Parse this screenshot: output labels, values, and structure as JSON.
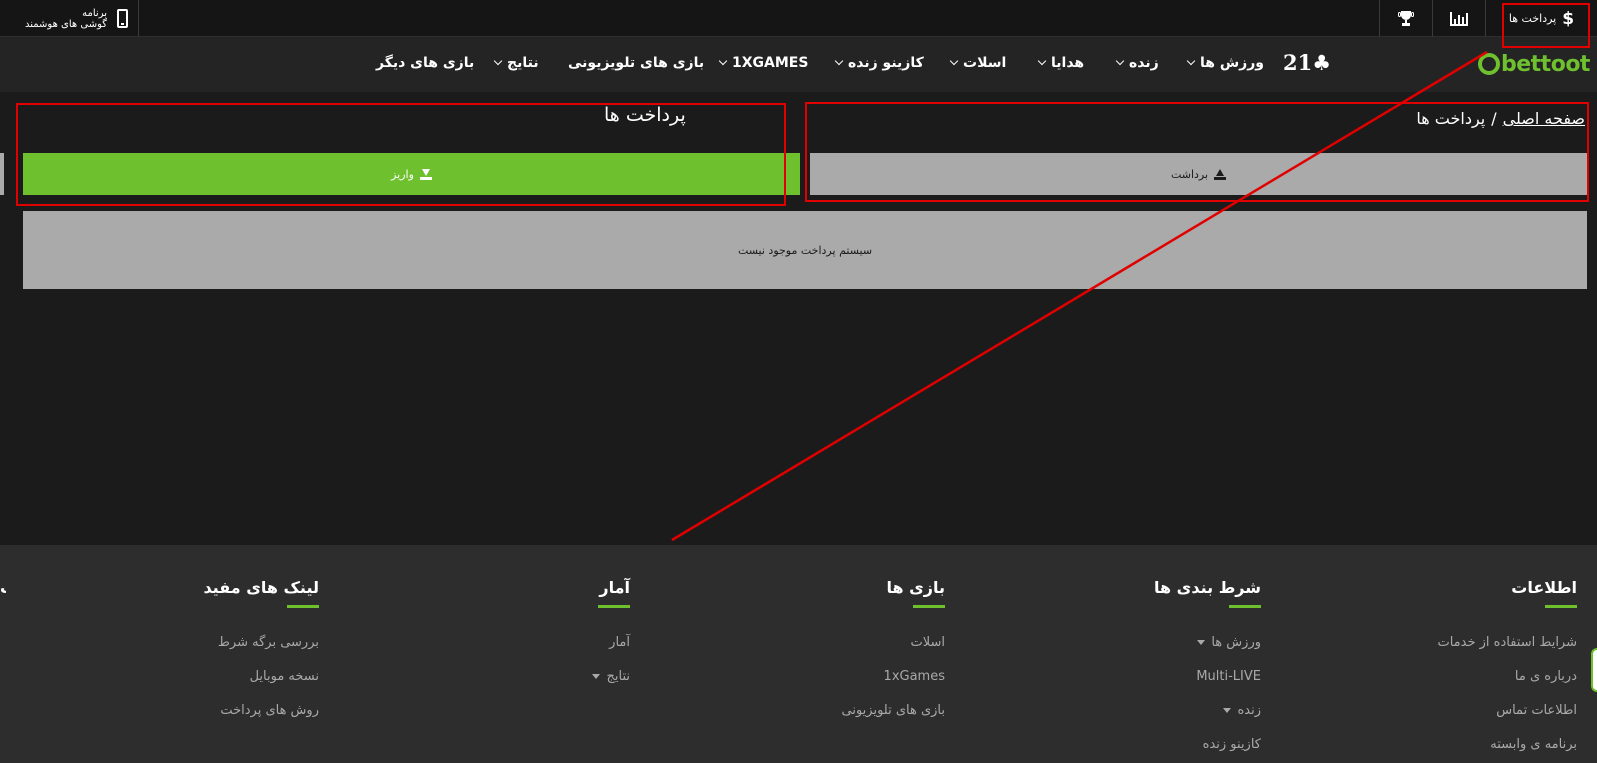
{
  "topbar": {
    "app_line1": "برنامه",
    "app_line2": "گوشی های هوشمند",
    "payments_label": "پرداخت ها",
    "dollar_symbol": "$"
  },
  "brand": {
    "logo_text": "bettoot",
    "logo21": "21♣"
  },
  "nav": {
    "items": [
      {
        "label": "ورزش ها",
        "dropdown": true
      },
      {
        "label": "زنده",
        "dropdown": true
      },
      {
        "label": "هدایا",
        "dropdown": true
      },
      {
        "label": "اسلات",
        "dropdown": true
      },
      {
        "label": "کازینو زنده",
        "dropdown": true
      },
      {
        "label": "1XGAMES",
        "dropdown": true
      },
      {
        "label": "بازی های تلویزیونی",
        "dropdown": false
      },
      {
        "label": "نتایج",
        "dropdown": true
      },
      {
        "label": "بازی های دیگر",
        "dropdown": false
      }
    ]
  },
  "breadcrumb": {
    "home": "صفحه اصلی",
    "separator": "/",
    "current": "پرداخت ها"
  },
  "page": {
    "title": "پرداخت ها",
    "deposit_label": "واریز",
    "withdraw_label": "برداشت",
    "notice": "سیستم پرداخت موجود نیست"
  },
  "footer": {
    "columns": [
      {
        "heading": "اطلاعات",
        "links": [
          {
            "label": "شرایط استفاده از خدمات"
          },
          {
            "label": "درباره ی ما"
          },
          {
            "label": "اطلاعات تماس"
          },
          {
            "label": "برنامه ی وابسته"
          }
        ]
      },
      {
        "heading": "شرط بندی ها",
        "links": [
          {
            "label": "ورزش ها",
            "dropdown": true
          },
          {
            "label": "Multi-LIVE"
          },
          {
            "label": "زنده",
            "dropdown": true
          },
          {
            "label": "کازینو زنده"
          }
        ]
      },
      {
        "heading": "بازی ها",
        "links": [
          {
            "label": "اسلات"
          },
          {
            "label": "1xGames"
          },
          {
            "label": "بازی های تلویزیونی"
          }
        ]
      },
      {
        "heading": "آمار",
        "links": [
          {
            "label": "آمار"
          },
          {
            "label": "نتایج",
            "dropdown": true
          }
        ]
      },
      {
        "heading": "لینک های مفید",
        "links": [
          {
            "label": "بررسی برگه شرط"
          },
          {
            "label": "نسخه موبایل"
          },
          {
            "label": "روش های پرداخت"
          }
        ]
      }
    ]
  },
  "colors": {
    "accent_green": "#6ec02e",
    "annotation_red": "#e00000",
    "button_gray": "#aaaaaa"
  }
}
